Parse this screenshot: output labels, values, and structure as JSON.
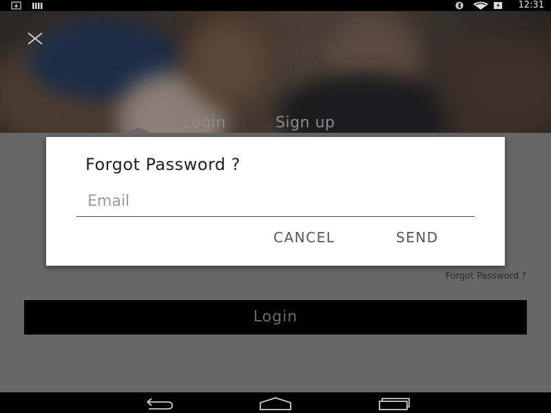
{
  "status_bar": {
    "time": "12:31",
    "icons": [
      "download-icon",
      "bars-icon",
      "bluetooth-icon",
      "wifi-icon",
      "battery-icon"
    ]
  },
  "header": {
    "tabs": [
      {
        "label": "Login",
        "selected": true
      },
      {
        "label": "Sign up",
        "selected": false
      }
    ]
  },
  "main": {
    "forgot_link": "Forgot Password ?",
    "login_button": "Login"
  },
  "dialog": {
    "title": "Forgot Password ?",
    "email_placeholder": "Email",
    "cancel_label": "CANCEL",
    "send_label": "SEND"
  },
  "nav_bar": {
    "icons": [
      "back-icon",
      "home-icon",
      "recents-icon"
    ]
  },
  "colors": {
    "scrim": "#676767",
    "dialog_bg": "#ffffff",
    "button_bg": "#000000"
  }
}
